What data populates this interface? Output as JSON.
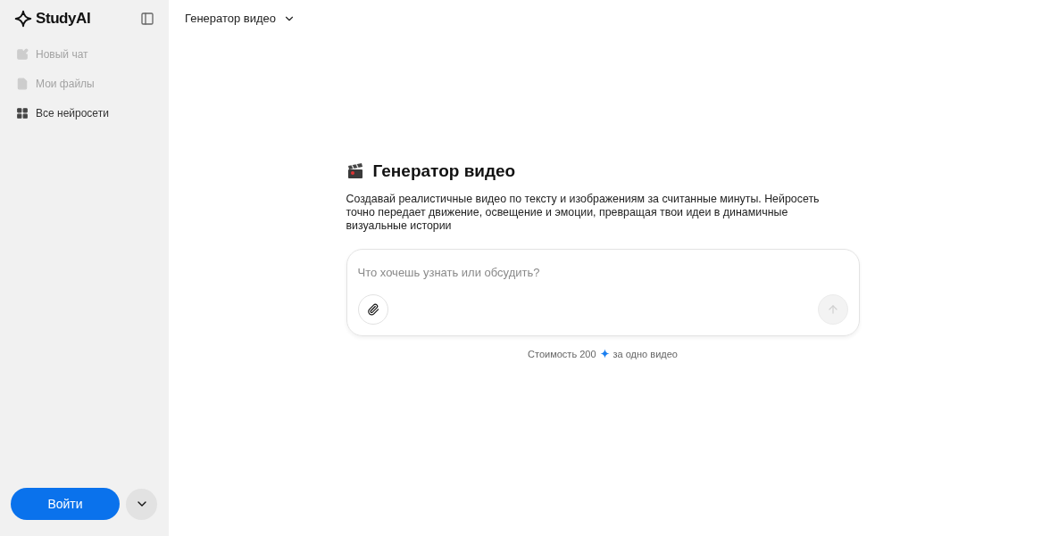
{
  "sidebar": {
    "logo": "StudyAI",
    "items": [
      {
        "kind": "edit",
        "label": "Новый чат",
        "disabled": true
      },
      {
        "kind": "file",
        "label": "Мои файлы",
        "disabled": true
      },
      {
        "kind": "grid",
        "label": "Все нейросети",
        "disabled": false
      }
    ],
    "login_button": "Войти"
  },
  "header": {
    "model_selector": "Генератор видео"
  },
  "main": {
    "title": "Генератор видео",
    "description": "Создавай реалистичные видео по тексту и изображениям за считанные минуты. Нейросеть точно передает движение, освещение и эмоции, превращая твои идеи в динамичные визуальные истории",
    "input": {
      "placeholder": "Что хочешь узнать или обсудить?"
    },
    "send_disabled": true,
    "cost_prefix": "Стоимость 200",
    "cost_suffix": "за одно видео"
  }
}
